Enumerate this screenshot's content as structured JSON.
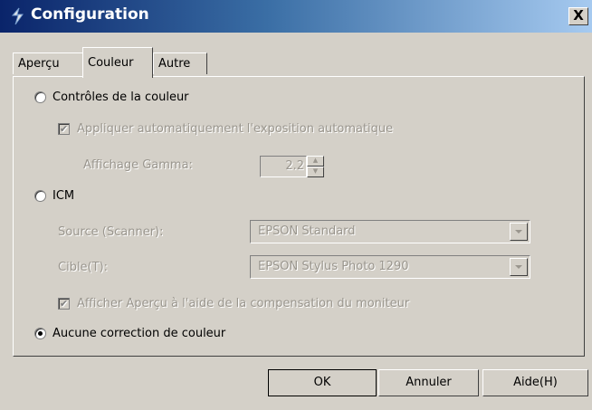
{
  "window": {
    "title": "Configuration",
    "close_label": "X",
    "icon": "epson-scan-icon"
  },
  "tabs": [
    {
      "label": "Aperçu",
      "active": false
    },
    {
      "label": "Couleur",
      "active": true
    },
    {
      "label": "Autre",
      "active": false
    }
  ],
  "color_panel": {
    "color_controls": {
      "label": "Contrôles de la couleur",
      "selected": false
    },
    "auto_exposure": {
      "label": "Appliquer automatiquement l'exposition automatique",
      "checked": true,
      "enabled": false
    },
    "gamma": {
      "label": "Affichage Gamma:",
      "value": "2.2",
      "enabled": false
    },
    "icm": {
      "label": "ICM",
      "selected": false
    },
    "source": {
      "label": "Source (Scanner):",
      "value": "EPSON Standard",
      "enabled": false
    },
    "target": {
      "label": "Cible(T):",
      "value": "EPSON Stylus Photo 1290",
      "enabled": false
    },
    "monitor_comp": {
      "label": "Afficher Aperçu à l'aide de la compensation du moniteur",
      "checked": true,
      "enabled": false
    },
    "no_correction": {
      "label": "Aucune correction de couleur",
      "selected": true
    }
  },
  "buttons": {
    "ok": "OK",
    "cancel": "Annuler",
    "help": "Aide(H)"
  }
}
